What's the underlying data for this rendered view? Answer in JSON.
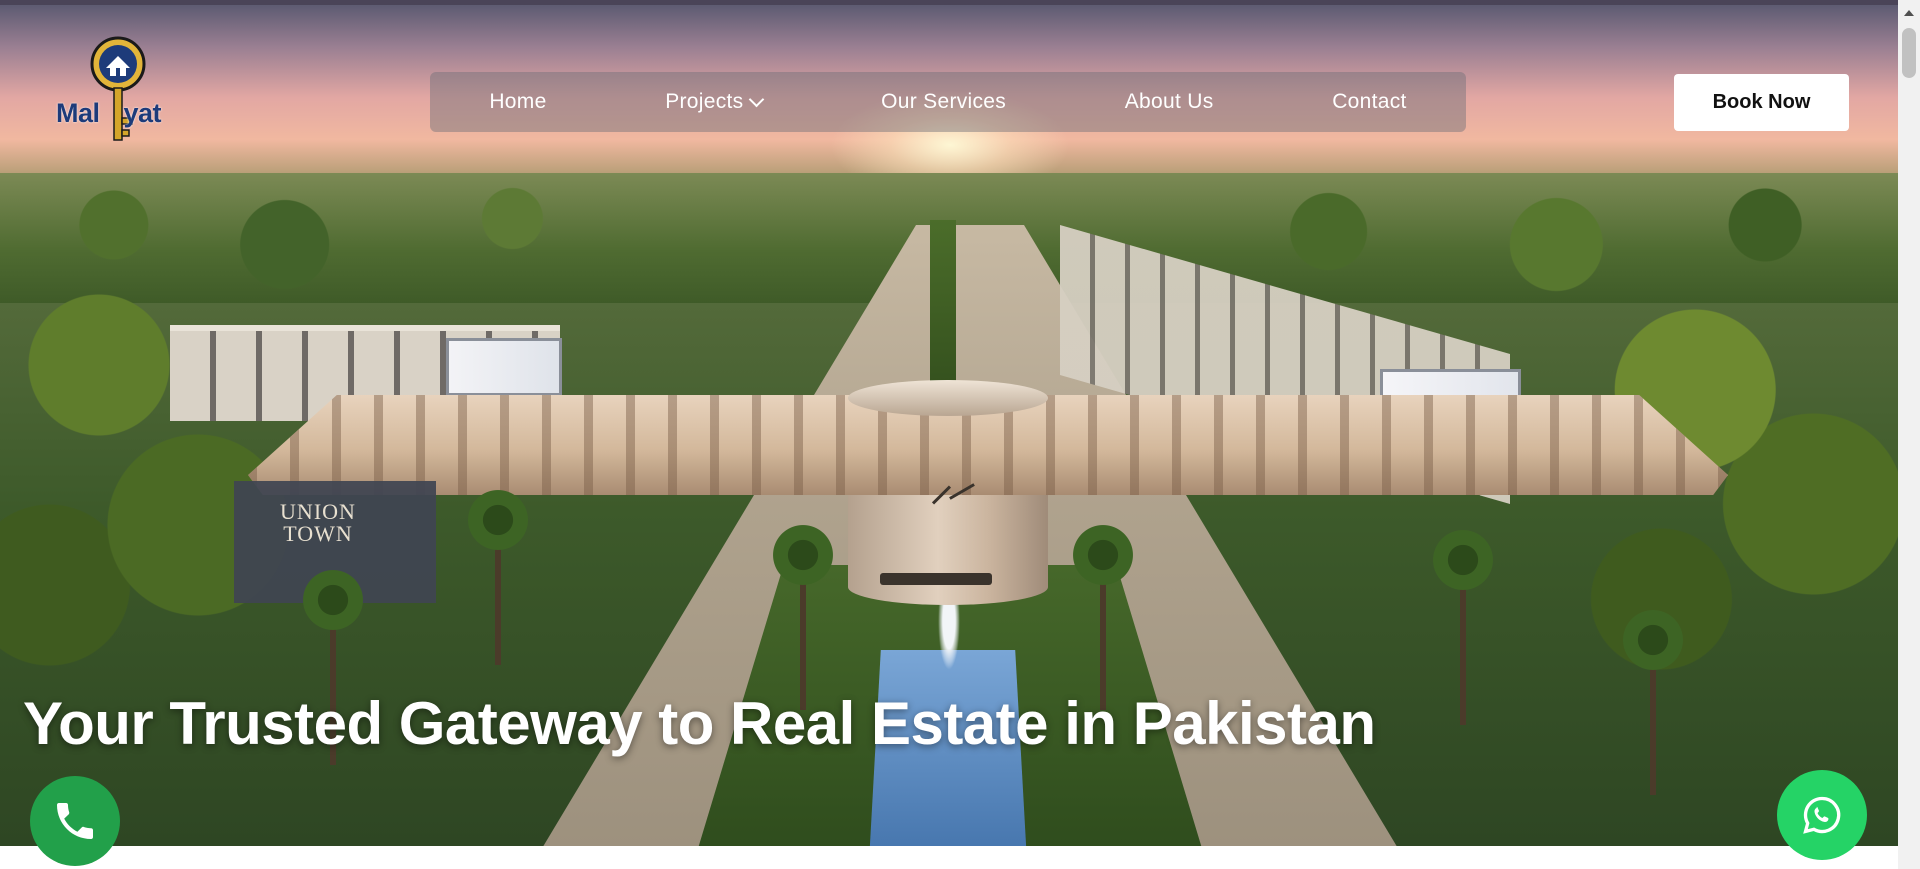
{
  "brand": {
    "logo_text_left": "Mal",
    "logo_text_right": "yat",
    "brand_color": "#1d3b7a",
    "key_color": "#d4a52a"
  },
  "nav": {
    "items": [
      {
        "label": "Home",
        "has_dropdown": false
      },
      {
        "label": "Projects",
        "has_dropdown": true
      },
      {
        "label": "Our Services",
        "has_dropdown": false
      },
      {
        "label": "About Us",
        "has_dropdown": false
      },
      {
        "label": "Contact",
        "has_dropdown": false
      }
    ]
  },
  "header": {
    "book_button_label": "Book Now"
  },
  "hero": {
    "title": "Your Trusted Gateway to Real Estate in Pakistan",
    "sign_text_line1": "UNION",
    "sign_text_line2": "TOWN"
  },
  "floating_actions": {
    "call_icon": "phone-icon",
    "call_color": "#22a04a",
    "whatsapp_icon": "whatsapp-icon",
    "whatsapp_color": "#25d366"
  }
}
